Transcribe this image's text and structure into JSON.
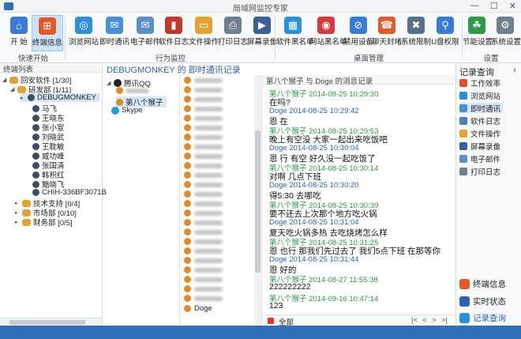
{
  "window": {
    "title": "局域网监控专家"
  },
  "colors": {
    "accent": "#2b63b0",
    "status_bar": "#2f6fb7",
    "timestamp_green": "#2e9a46",
    "timestamp_blue": "#2b63b0"
  },
  "ribbon": {
    "groups": [
      {
        "label": "快速开始"
      },
      {
        "label": "行为监控"
      },
      {
        "label": "桌面管理"
      },
      {
        "label": "设置"
      }
    ],
    "buttons": [
      {
        "label": "开 始",
        "icon": "home-icon"
      },
      {
        "label": "终端信息",
        "icon": "windows-icon"
      },
      {
        "label": "浏览网站",
        "icon": "browser-icon"
      },
      {
        "label": "即时通讯",
        "icon": "chat-icon"
      },
      {
        "label": "电子邮件",
        "icon": "mail-icon"
      },
      {
        "label": "软件日志",
        "icon": "software-log-icon"
      },
      {
        "label": "文件操作",
        "icon": "folder-icon"
      },
      {
        "label": "打印日志",
        "icon": "printer-icon"
      },
      {
        "label": "屏幕录像",
        "icon": "film-icon"
      },
      {
        "label": "软件黑名单",
        "icon": "app-blacklist-icon"
      },
      {
        "label": "网站黑名单",
        "icon": "web-blacklist-icon"
      },
      {
        "label": "禁用设备",
        "icon": "device-block-icon"
      },
      {
        "label": "聊天封堵",
        "icon": "chat-block-icon"
      },
      {
        "label": "系统限制",
        "icon": "tools-icon"
      },
      {
        "label": "U盘权限",
        "icon": "usb-icon"
      },
      {
        "label": "节能设置",
        "icon": "energy-icon"
      },
      {
        "label": "系统设置",
        "icon": "gear-icon"
      }
    ]
  },
  "left_panel": {
    "header": "终端列表",
    "root": "回安软件 [1/30]",
    "groups": [
      {
        "name": "研发部 [1/11]"
      },
      {
        "name": "技术支持 [0/4]"
      },
      {
        "name": "市场部 [0/10]"
      },
      {
        "name": "财务部 [0/5]"
      }
    ],
    "members": [
      "DEBUGMONKEY",
      "马飞",
      "王晓东",
      "张小宣",
      "刘晓武",
      "王耽敏",
      "威功峰",
      "张国清",
      "韩积红",
      "黯晓飞",
      "CHIH-336BF3071B"
    ]
  },
  "center": {
    "title": "DEBUGMONKEY 的 即时通讯记录",
    "accounts": [
      {
        "name": "腾讯QQ",
        "icon": "qq-icon"
      },
      {
        "name": "第八个猴子",
        "icon": "user-icon"
      },
      {
        "name": "Skype",
        "icon": "skype-icon"
      }
    ],
    "contacts_last": "Doge",
    "message_header": "第八个猴子 与 Doge 的消息记录",
    "messages": [
      {
        "who": "第八个猴子",
        "time": "2014-08-25 10:29:30",
        "text": "在吗?",
        "side": "self"
      },
      {
        "who": "Doge",
        "time": "2014-08-25 10:29:42",
        "text": "恩 在",
        "side": "other"
      },
      {
        "who": "第八个猴子",
        "time": "2014-08-25 10:29:53",
        "text": "晚上有空没 大家一起出来吃饭吧",
        "side": "self"
      },
      {
        "who": "Doge",
        "time": "2014-08-25 10:30:04",
        "text": "恩 行 有空 好久没一起吃饭了",
        "side": "other"
      },
      {
        "who": "第八个猴子",
        "time": "2014-08-25 10:30:14",
        "text": "对啊 几点下班",
        "side": "self"
      },
      {
        "who": "Doge",
        "time": "2014-08-25 10:30:20",
        "text": "得5:30 去哪吃",
        "side": "other"
      },
      {
        "who": "第八个猴子",
        "time": "2014-08-25 10:30:39",
        "text": "要不还去上次那个地方吃火锅",
        "side": "self"
      },
      {
        "who": "Doge",
        "time": "2014-08-25 10:31:04",
        "text": "夏天吃火锅多热 去吃烧烤怎么样",
        "side": "other"
      },
      {
        "who": "第八个猴子",
        "time": "2014-08-25 10:31:25",
        "text": "恩 也行 那我们先过去了 我们5点下班 在那等你",
        "side": "self"
      },
      {
        "who": "Doge",
        "time": "2014-08-25 10:31:44",
        "text": "恩 好的",
        "side": "other"
      },
      {
        "who": "第八个猴子",
        "time": "2014-08-27 11:55:38",
        "text": "222222222",
        "side": "self"
      },
      {
        "who": "第八个猴子",
        "time": "2014-09-16 10:47:14",
        "text": "123",
        "side": "self"
      }
    ],
    "footer_label": "全部",
    "pager": [
      "|<",
      "<",
      ">",
      ">|"
    ]
  },
  "right_panel": {
    "header": "记录查询",
    "items": [
      {
        "label": "工作效率",
        "icon": "efficiency-icon",
        "color": "#e0502b"
      },
      {
        "label": "浏览网站",
        "icon": "browser-icon",
        "color": "#2b8fd9"
      },
      {
        "label": "即时通讯",
        "icon": "chat-icon",
        "color": "#4a90d9"
      },
      {
        "label": "软件日志",
        "icon": "software-log-icon",
        "color": "#4a7fbf"
      },
      {
        "label": "文件操作",
        "icon": "folder-icon",
        "color": "#e2a235"
      },
      {
        "label": "屏幕录像",
        "icon": "film-icon",
        "color": "#3a5f9a"
      },
      {
        "label": "电子邮件",
        "icon": "mail-icon",
        "color": "#5a8fcc"
      },
      {
        "label": "打印日志",
        "icon": "printer-icon",
        "color": "#6f7f90"
      }
    ],
    "bottom": [
      {
        "label": "终端信息",
        "icon": "windows-icon"
      },
      {
        "label": "实时状态",
        "icon": "monitor-icon"
      },
      {
        "label": "记录查询",
        "icon": "search-icon"
      }
    ]
  }
}
